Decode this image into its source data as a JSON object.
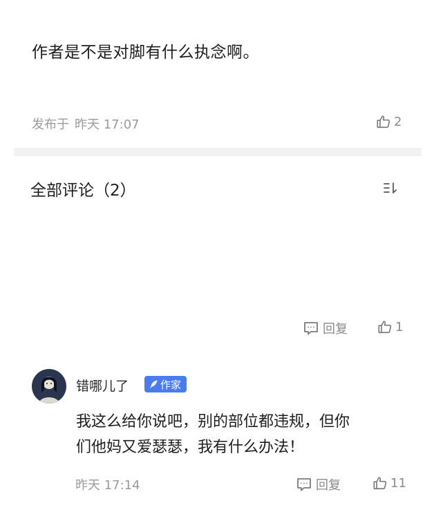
{
  "post": {
    "text": "作者是不是对脚有什么执念啊。",
    "published_label": "发布于",
    "time": "昨天 17:07",
    "likes": "2"
  },
  "comments_section": {
    "title": "全部评论（2）"
  },
  "comment1": {
    "reply_label": "回复",
    "likes": "1"
  },
  "comment2": {
    "username": "错哪儿了",
    "badge": "作家",
    "text_lines": [
      "我这么给你说吧，别的部位都违规，但你",
      "们他妈又爱瑟瑟，我有什么办法！"
    ],
    "time": "昨天 17:14",
    "reply_label": "回复",
    "likes": "11"
  },
  "colors": {
    "badge": "#4a7cf0",
    "muted": "#9a9a9a",
    "divider": "#f2f2f4"
  }
}
